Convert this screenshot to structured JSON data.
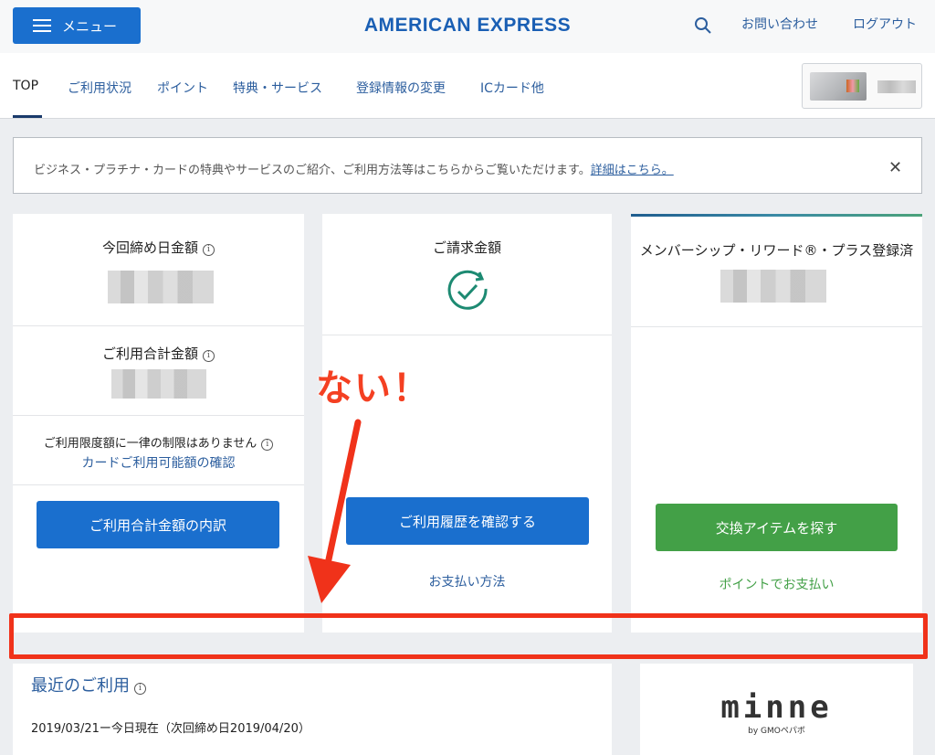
{
  "header": {
    "menu_label": "メニュー",
    "brand": "AMERICAN EXPRESS",
    "contact": "お問い合わせ",
    "logout": "ログアウト"
  },
  "nav": {
    "items": [
      "TOP",
      "ご利用状況",
      "ポイント",
      "特典・サービス",
      "登録情報の変更",
      "ICカード他"
    ]
  },
  "notice": {
    "text": "ビジネス・プラチナ・カードの特典やサービスのご紹介、ご利用方法等はこちらからご覧いただけます。",
    "link": "詳細はこちら。",
    "close": "✕"
  },
  "panel_billing": {
    "closing_label": "今回締め日金額",
    "usage_total_label": "ご利用合計金額",
    "limit_text": "ご利用限度額に一律の制限はありません",
    "limit_link": "カードご利用可能額の確認",
    "button": "ご利用合計金額の内訳"
  },
  "panel_invoice": {
    "label": "ご請求金額",
    "button": "ご利用履歴を確認する",
    "link": "お支払い方法"
  },
  "panel_rewards": {
    "label": "メンバーシップ・リワード®・プラス登録済",
    "button": "交換アイテムを探す",
    "link": "ポイントでお支払い"
  },
  "annotation": {
    "text": "ない！",
    "color": "#f0321a"
  },
  "recent": {
    "title": "最近のご利用",
    "period": "2019/03/21ー今日現在（次回締め日2019/04/20）"
  },
  "ad": {
    "logo": "minne",
    "sub": "by GMOペパボ"
  },
  "info_glyph": "i",
  "colors": {
    "primary_blue": "#1a6fce",
    "green": "#43a047",
    "link": "#2c5e9e"
  }
}
